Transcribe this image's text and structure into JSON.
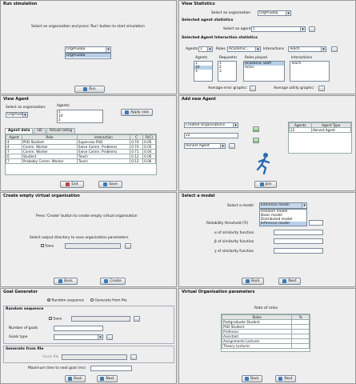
{
  "run": {
    "title": "Run simulation",
    "instruction": "Select an organisation and press 'Run' button to start simulation",
    "org_value": "OrgPrueba",
    "dropdown_option": "OrgPrueba",
    "run_btn": "Run"
  },
  "stats": {
    "title": "View Statistics",
    "org_label": "Select an organisation",
    "org_value": "OrgPrueba",
    "agent_section": "Selected agent statistics",
    "agent_label": "Select an agent",
    "agent_value": "1",
    "inter_section": "Selected Agent Interaction statistics",
    "agents_label": "Agents",
    "agents_value": "1",
    "roles_label": "Roles",
    "roles_value": "Academic...",
    "interactions_label": "Interactions",
    "interactions_value": "Teach",
    "col_agents": "Agents",
    "col_requester": "Requester",
    "col_roles": "Roles played",
    "col_interactions": "Interactions",
    "agents_list": [
      "1",
      "10",
      "3"
    ],
    "requester_list": [
      "1",
      "2",
      "3"
    ],
    "roles_list": [
      "Academic Staff",
      "Actor"
    ],
    "interactions_list": [
      "Teach"
    ],
    "avg_error": "Average error graphic:",
    "avg_utility": "Average utility graphic:"
  },
  "view_agent": {
    "title": "View Agent",
    "org_label": "Select an organisation:",
    "org_value": "OrgPrueba",
    "agents_label": "Agents:",
    "agents_list": [
      "1",
      "10",
      "2"
    ],
    "apply_btn": "Apply now",
    "tabs": [
      "Agent data",
      "LIE",
      "Actual rating"
    ],
    "headers": [
      "",
      "Agent",
      "Role",
      "Interaction",
      "C",
      "R(C)"
    ],
    "rows": [
      [
        "4",
        "PhD Student",
        "Supervise PhD",
        "0.74",
        "0.05"
      ],
      [
        "4",
        "Comm. Worker",
        "Solve Comm. Problems",
        "0.74",
        "0.05"
      ],
      [
        "7",
        "Comm. Worker",
        "Solve Comm. Problems",
        "0.71",
        "0.04"
      ],
      [
        "6",
        "Student",
        "Teach",
        "0.12",
        "0.06"
      ],
      [
        "7",
        "Probably Comm. Worker",
        "Teach",
        "0.12",
        "0.06"
      ]
    ],
    "exit_btn": "Exit",
    "save_btn": "Save"
  },
  "add_agent": {
    "title": "Add new Agent",
    "created_orgs": "Created Organisations",
    "field_value": "22",
    "type_value": "Honest Agent",
    "col_agents": "Agents",
    "col_type": "Agent Type",
    "row_agent": "22",
    "row_type": "Honest Agent",
    "join_btn": "Join"
  },
  "create_org": {
    "title": "Create empty virtual organisation",
    "instruction": "Press 'Create' button to create empty virtual organisation",
    "dir_label": "Select output directory to save organisation parameters",
    "save_label": "Save",
    "back_btn": "Back",
    "create_btn": "Create"
  },
  "select_model": {
    "title": "Select a model",
    "model_label": "Select a model",
    "model_value": "Inference model",
    "options": [
      "Random model",
      "Basic model",
      "Distributed model",
      "Inference model"
    ],
    "reliability": "Reliability threshold (Tr)",
    "alpha": "α of similarity function",
    "beta": "β of similarity function",
    "gamma": "γ of similarity function",
    "back_btn": "Back",
    "next_btn": "Next"
  },
  "goal_gen": {
    "title": "Goal Generator",
    "random_seq": "Random sequence",
    "from_file": "Generate from file",
    "random_section": "Random sequence",
    "save_label": "Save",
    "num_goals": "Number of goals",
    "goals_type": "Goals type",
    "file_section": "Generate from file",
    "goals_file": "Goals file",
    "max_time": "Maximum time to next goal (ms)",
    "back_btn": "Back",
    "next_btn": "Next"
  },
  "vo_params": {
    "title": "Virtual Organisation parameters",
    "rate_title": "Rate of roles",
    "col_roles": "Roles",
    "col_pct": "%",
    "roles": [
      "Postgraduate Student",
      "PhD Student",
      "Professor",
      "Assistant",
      "Assignments Lecturer",
      "Theory Lecturer"
    ],
    "back_btn": "Back",
    "next_btn": "Next"
  }
}
